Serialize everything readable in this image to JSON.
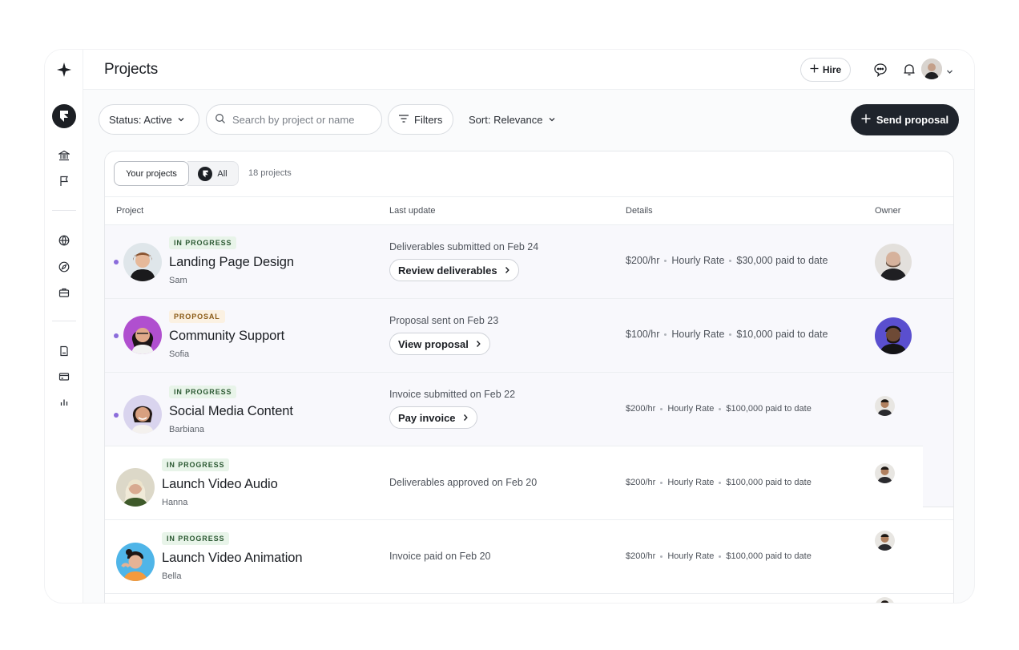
{
  "header": {
    "title": "Projects",
    "hire_label": "Hire"
  },
  "toolbar": {
    "status_label": "Status: Active",
    "search_placeholder": "Search by project or name",
    "filters_label": "Filters",
    "sort_label": "Sort: Relevance",
    "send_label": "Send proposal"
  },
  "panel": {
    "tab_your": "Your projects",
    "tab_all": "All",
    "count": "18 projects",
    "columns": [
      "Project",
      "Last update",
      "Details",
      "Owner"
    ]
  },
  "rows": [
    {
      "badge": "IN PROGRESS",
      "name": "Landing Page Design",
      "owner": "Sam",
      "update": "Deliverables submitted on Feb 24",
      "action": "Review deliverables",
      "rate": "$200/hr",
      "rate_type": "Hourly Rate",
      "paid": "$30,000 paid to date"
    },
    {
      "badge": "PROPOSAL",
      "name": "Community Support",
      "owner": "Sofia",
      "update": "Proposal sent on Feb 23",
      "action": "View proposal",
      "rate": "$100/hr",
      "rate_type": "Hourly Rate",
      "paid": "$10,000 paid to date"
    },
    {
      "badge": "IN PROGRESS",
      "name": "Social Media Content",
      "owner": "Barbiana",
      "update": "Invoice submitted on Feb 22",
      "action": "Pay invoice",
      "rate": "$200/hr",
      "rate_type": "Hourly Rate",
      "paid": "$100,000 paid to date"
    },
    {
      "badge": "IN PROGRESS",
      "name": "Launch Video Audio",
      "owner": "Hanna",
      "update": "Deliverables approved on Feb 20",
      "action": "",
      "rate": "$200/hr",
      "rate_type": "Hourly Rate",
      "paid": "$100,000 paid to date"
    },
    {
      "badge": "IN PROGRESS",
      "name": "Launch Video Animation",
      "owner": "Bella",
      "update": "Invoice paid on Feb 20",
      "action": "",
      "rate": "$200/hr",
      "rate_type": "Hourly Rate",
      "paid": "$100,000 paid to date"
    }
  ],
  "colors": {
    "accent_dark": "#1f242c",
    "unread_dot": "#8b6cdb",
    "in_progress_bg": "#e8f4e9",
    "proposal_bg": "#fbf1e2"
  },
  "icons": [
    "brand-star-icon",
    "brand-logo-icon",
    "bank-icon",
    "flag-icon",
    "globe-icon",
    "compass-icon",
    "briefcase-icon",
    "document-icon",
    "card-icon",
    "chart-icon",
    "plus-icon",
    "chat-icon",
    "bell-icon",
    "chevron-down-icon",
    "search-icon",
    "filter-icon",
    "chevron-right-icon"
  ]
}
